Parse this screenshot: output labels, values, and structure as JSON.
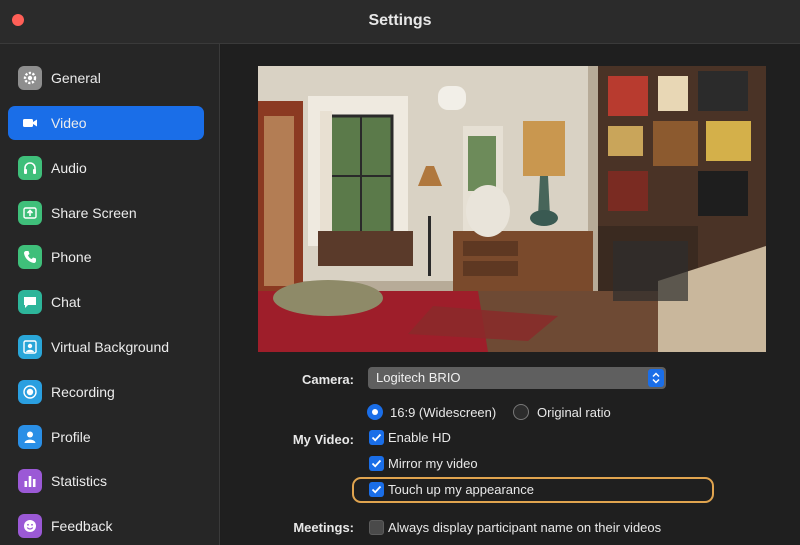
{
  "window": {
    "title": "Settings"
  },
  "sidebar": {
    "items": [
      {
        "label": "General",
        "icon": "gear-icon",
        "color": "#8e8e8e",
        "active": false
      },
      {
        "label": "Video",
        "icon": "video-camera-icon",
        "color": "#1a6ee8",
        "active": true
      },
      {
        "label": "Audio",
        "icon": "headphones-icon",
        "color": "#3fbf7a",
        "active": false
      },
      {
        "label": "Share Screen",
        "icon": "share-screen-icon",
        "color": "#3fbf7a",
        "active": false
      },
      {
        "label": "Phone",
        "icon": "phone-icon",
        "color": "#3fbf7a",
        "active": false
      },
      {
        "label": "Chat",
        "icon": "chat-bubble-icon",
        "color": "#2db59a",
        "active": false
      },
      {
        "label": "Virtual Background",
        "icon": "virtual-background-icon",
        "color": "#2aa6d8",
        "active": false
      },
      {
        "label": "Recording",
        "icon": "record-icon",
        "color": "#2a9fe0",
        "active": false
      },
      {
        "label": "Profile",
        "icon": "person-icon",
        "color": "#2a8fe6",
        "active": false
      },
      {
        "label": "Statistics",
        "icon": "bar-chart-icon",
        "color": "#9b59d6",
        "active": false
      },
      {
        "label": "Feedback",
        "icon": "smiley-icon",
        "color": "#9b59d6",
        "active": false
      }
    ]
  },
  "video": {
    "camera_label": "Camera:",
    "camera_value": "Logitech BRIO",
    "my_video_label": "My Video:",
    "ratio_widescreen": "16:9 (Widescreen)",
    "ratio_original": "Original ratio",
    "enable_hd": "Enable HD",
    "mirror": "Mirror my video",
    "touch_up": "Touch up my appearance",
    "meetings_label": "Meetings:",
    "always_display": "Always display participant name on their videos"
  },
  "colors": {
    "accent": "#1a6ee8",
    "highlight": "#e0a44f"
  }
}
